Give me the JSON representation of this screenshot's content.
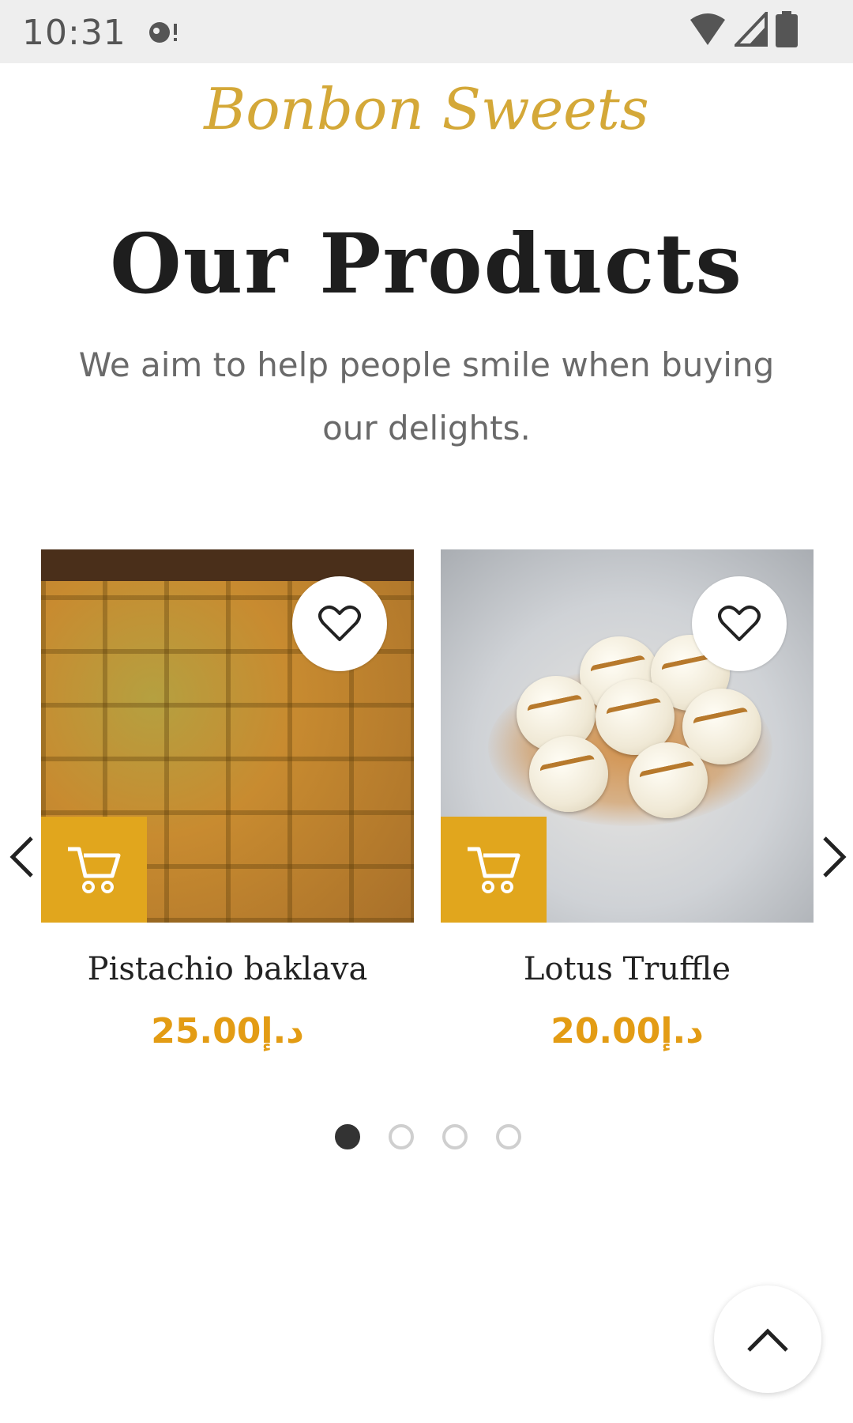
{
  "status_bar": {
    "time": "10:31"
  },
  "header": {
    "logo_text": "Bonbon Sweets"
  },
  "section": {
    "title": "Our Products",
    "subtitle": "We aim to help people smile when buying our delights."
  },
  "products": [
    {
      "name": "Pistachio baklava",
      "price": "25.00د.إ"
    },
    {
      "name": "Lotus Truffle",
      "price": "20.00د.إ"
    }
  ],
  "carousel": {
    "page_count": 4,
    "active_page": 1
  },
  "colors": {
    "brand_gold": "#d4a838",
    "cart_orange": "#e1a61d",
    "price_orange": "#e39c14"
  }
}
